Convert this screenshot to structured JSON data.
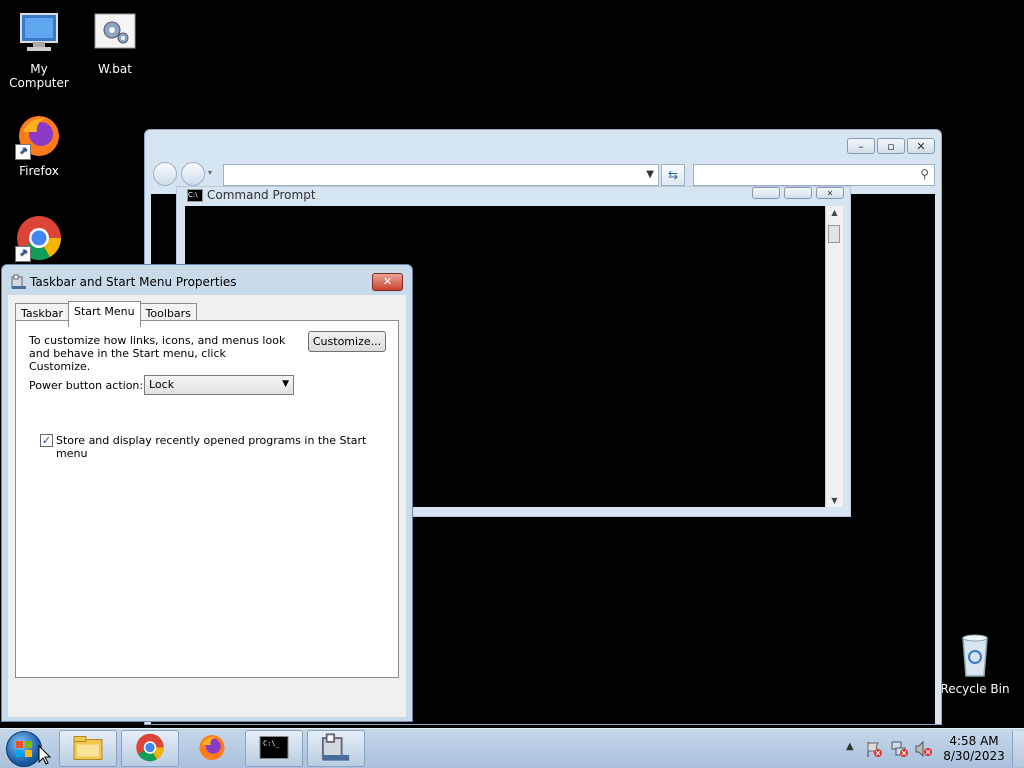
{
  "desktop": {
    "icons": [
      {
        "label": "My Computer",
        "icon": "computer-icon"
      },
      {
        "label": "W.bat",
        "icon": "batch-file-icon"
      },
      {
        "label": "Firefox",
        "icon": "firefox-icon"
      },
      {
        "label": "",
        "icon": "chrome-icon"
      },
      {
        "label": "Recycle Bin",
        "icon": "recycle-bin-icon"
      }
    ]
  },
  "explorer": {
    "address_value": "",
    "search_placeholder": ""
  },
  "cmd": {
    "title": "Command Prompt"
  },
  "dialog": {
    "title": "Taskbar and Start Menu Properties",
    "tabs": [
      "Taskbar",
      "Start Menu",
      "Toolbars"
    ],
    "active_tab": "Start Menu",
    "description": "To customize how links, icons, and menus look and behave in the Start menu, click Customize.",
    "customize_label": "Customize...",
    "power_label": "Power button action:",
    "power_value": "Lock",
    "recent_label": "Store and display recently opened programs in the Start menu",
    "recent_checked": true
  },
  "taskbar": {
    "time": "4:58 AM",
    "date": "8/30/2023",
    "pinned": [
      "file-explorer-icon",
      "chrome-icon",
      "firefox-icon",
      "command-prompt-icon",
      "taskbar-properties-icon"
    ]
  },
  "colors": {
    "desktop": "#000000",
    "window_frame": "#d7e4f2",
    "taskbar": "#b6cbe2",
    "close_button": "#c7432c"
  }
}
